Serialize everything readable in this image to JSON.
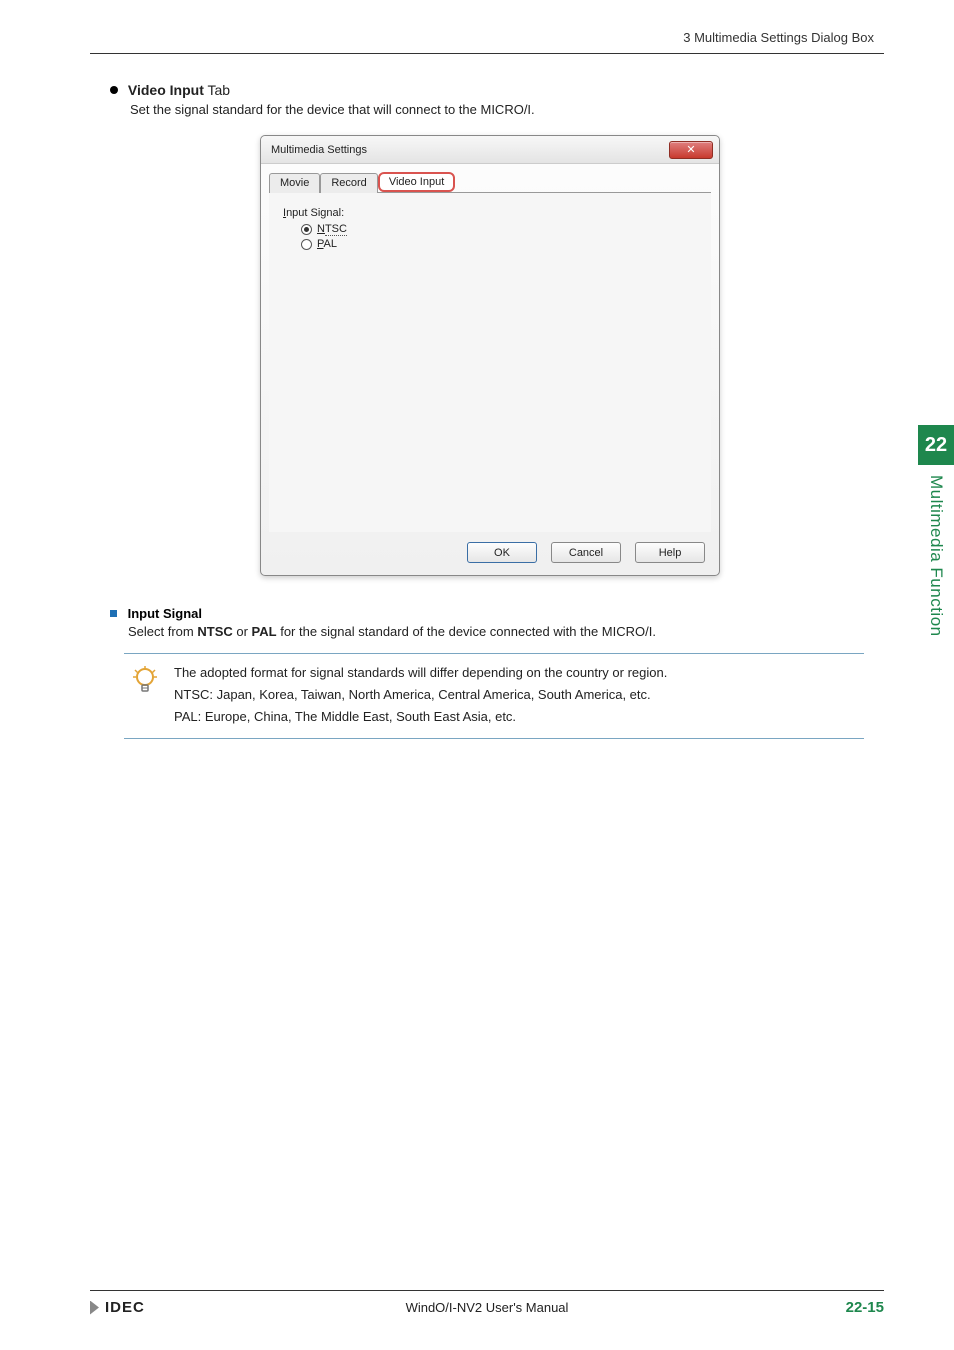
{
  "header": {
    "breadcrumb": "3 Multimedia Settings Dialog Box"
  },
  "section": {
    "title_bold": "Video Input",
    "title_suffix": " Tab",
    "desc": "Set the signal standard for the device that will connect to the MICRO/I."
  },
  "dialog": {
    "title": "Multimedia Settings",
    "close_glyph": "✕",
    "tabs": {
      "movie": "Movie",
      "record": "Record",
      "video_input": "Video Input"
    },
    "group_label": "Input Signal:",
    "options": {
      "ntsc": {
        "mnemonic": "N",
        "rest": "TSC",
        "selected": true
      },
      "pal": {
        "mnemonic": "P",
        "rest": "AL",
        "selected": false
      }
    },
    "buttons": {
      "ok": "OK",
      "cancel": "Cancel",
      "help": "Help"
    }
  },
  "subsection": {
    "title": "Input Signal",
    "desc_pre": "Select from ",
    "desc_b1": "NTSC",
    "desc_mid": " or ",
    "desc_b2": "PAL",
    "desc_post": " for the signal standard of the device connected with the MICRO/I."
  },
  "tip": {
    "line1": "The adopted format for signal standards will differ depending on the country or region.",
    "line2": "NTSC: Japan, Korea, Taiwan, North America, Central America, South America, etc.",
    "line3": "PAL: Europe, China, The Middle East, South East Asia, etc."
  },
  "side": {
    "chapter_no": "22",
    "chapter_title": "Multimedia Function"
  },
  "footer": {
    "brand": "IDEC",
    "center": "WindO/I-NV2 User's Manual",
    "page": "22-15"
  }
}
